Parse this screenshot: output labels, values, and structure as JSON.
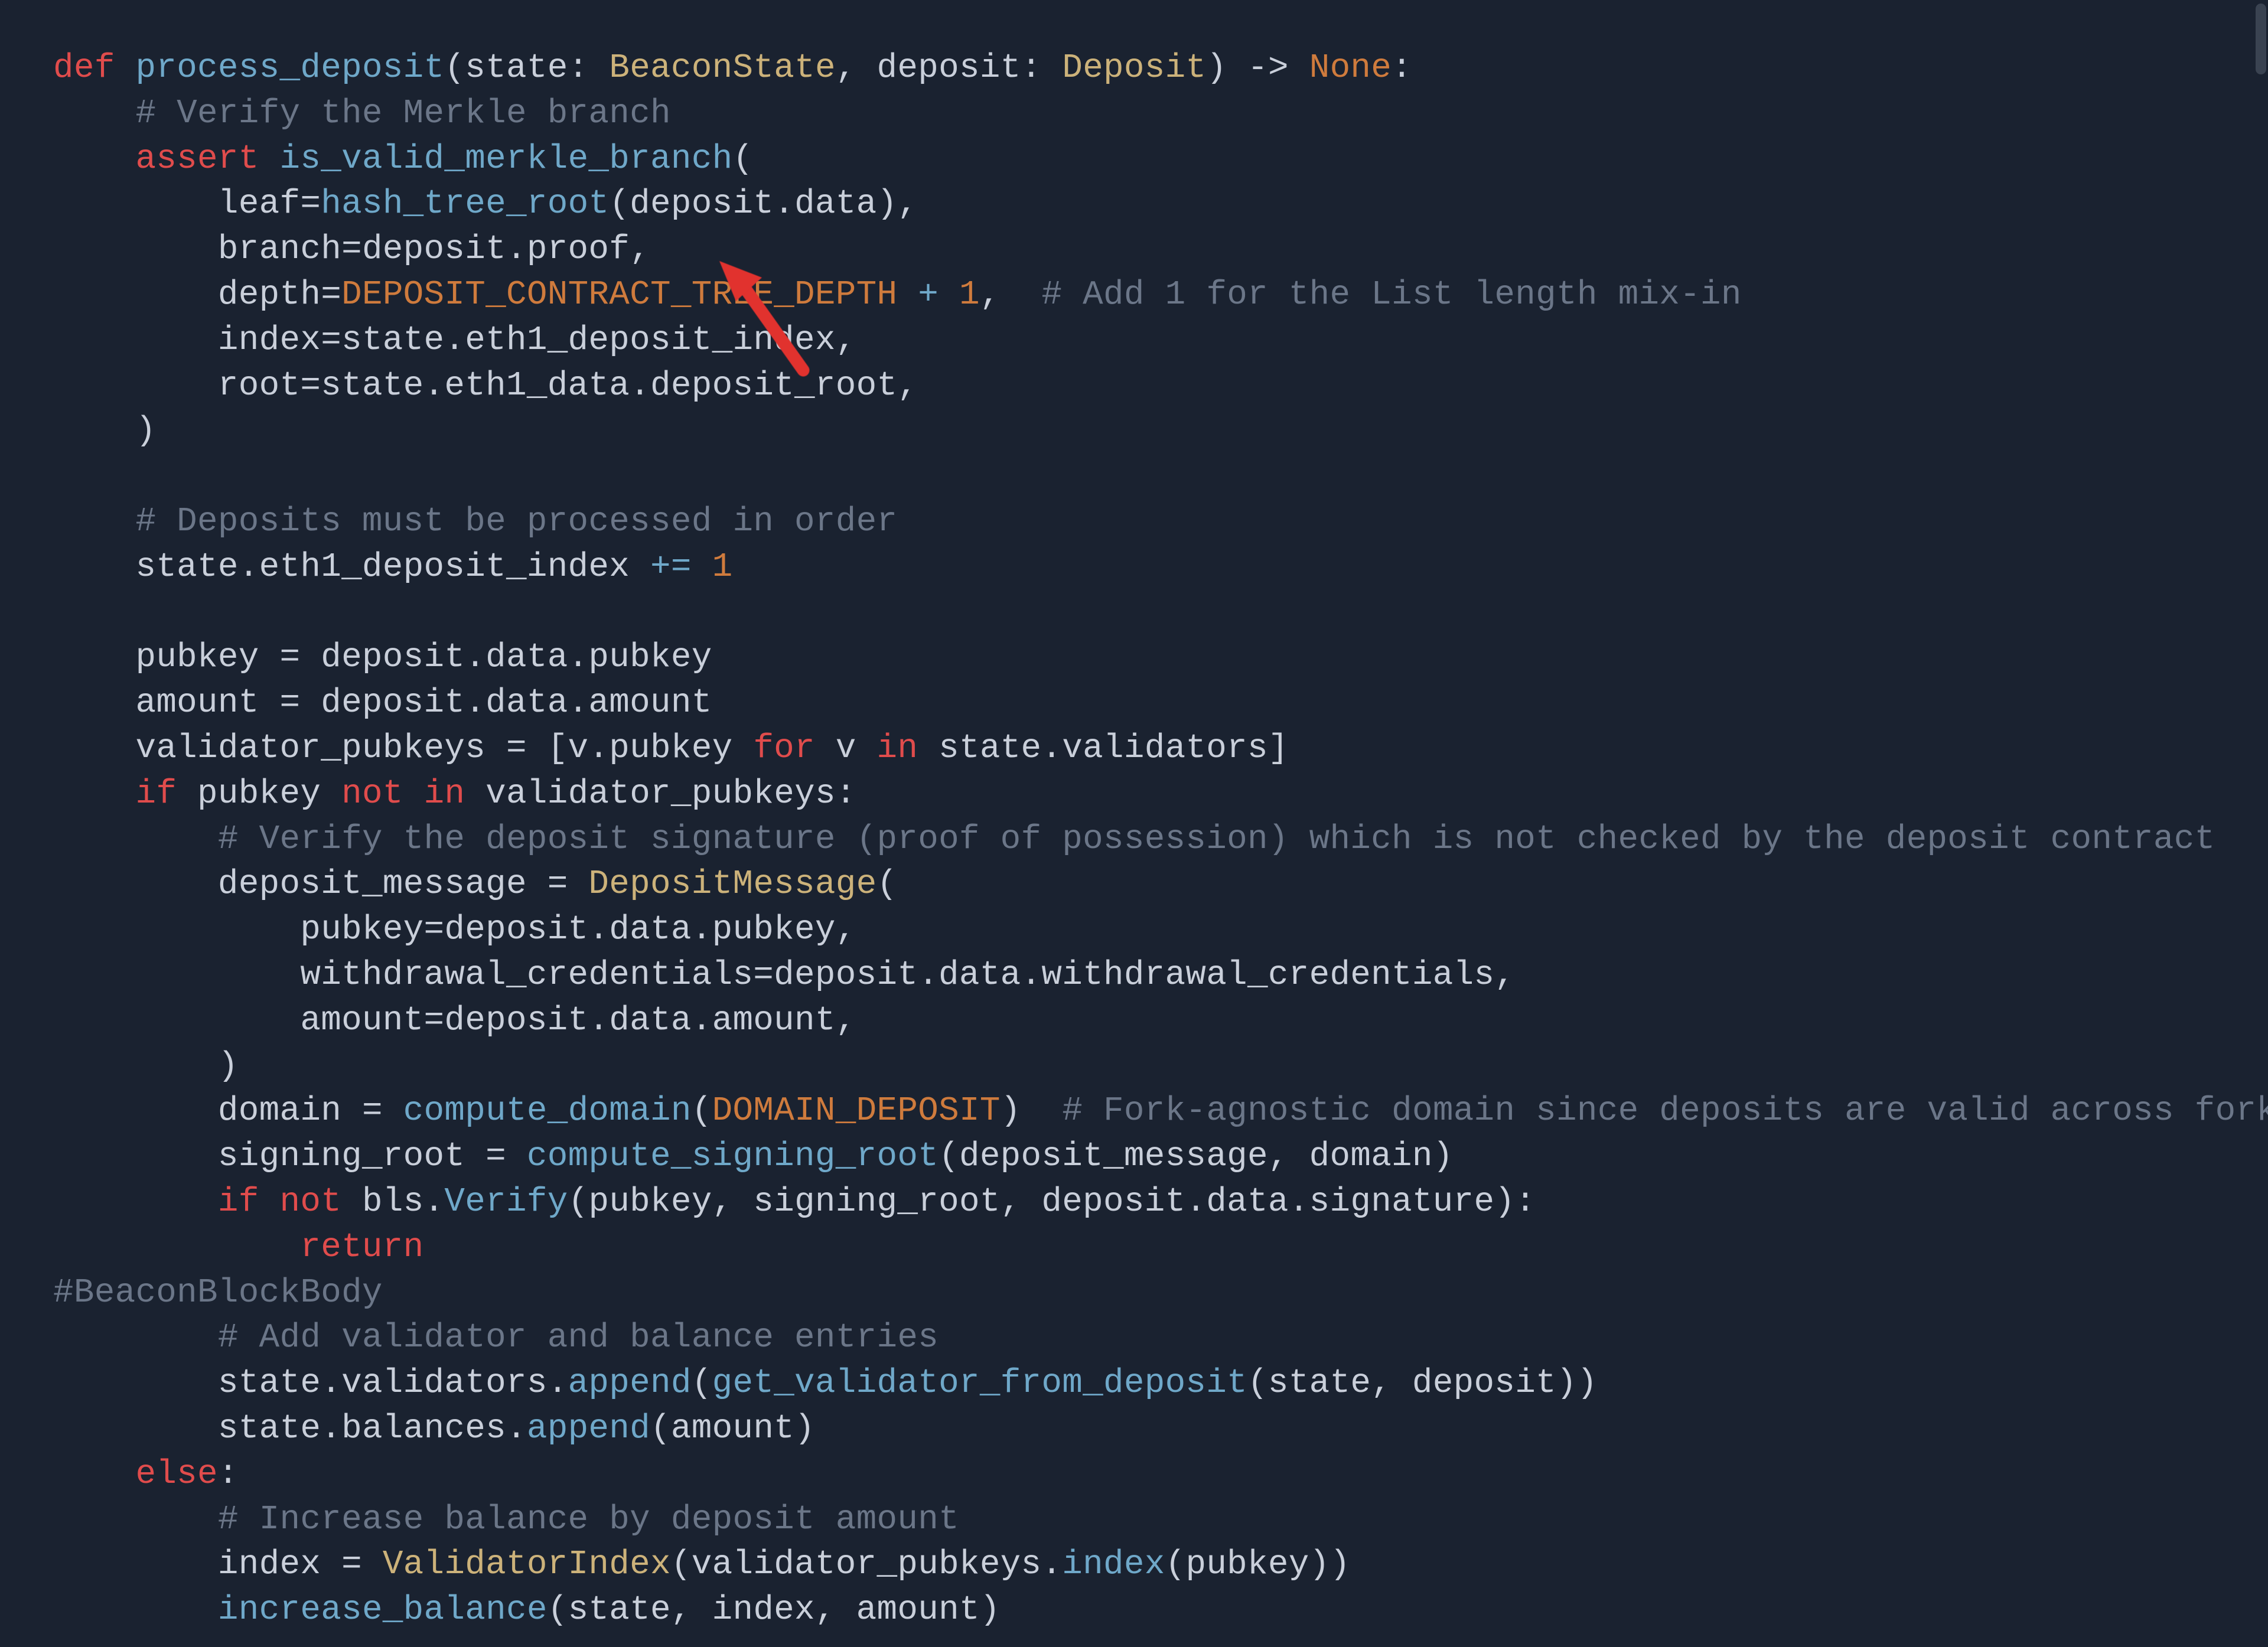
{
  "code": {
    "kw_def": "def",
    "fn_name": "process_deposit",
    "params_open": "(",
    "p1_name": "state",
    "p1_type": "BeaconState",
    "p2_name": "deposit",
    "p2_type": "Deposit",
    "params_close": ")",
    "arrow": " -> ",
    "ret_type": "None",
    "colon": ":",
    "c1": "# Verify the Merkle branch",
    "kw_assert": "assert",
    "fn_is_valid": "is_valid_merkle_branch",
    "open_paren": "(",
    "arg_leaf_k": "leaf",
    "arg_leaf_eq": "=",
    "fn_htr": "hash_tree_root",
    "arg_leaf_v": "(deposit.data),",
    "arg_branch": "branch=deposit.proof,",
    "arg_depth_k": "depth",
    "arg_depth_eq": "=",
    "const_depth": "DEPOSIT_CONTRACT_TREE_DEPTH",
    "plus": " + ",
    "num1": "1",
    "comma": ",",
    "c_depth": "# Add 1 for the List length mix-in",
    "arg_index": "index=state.eth1_deposit_index,",
    "arg_root": "root=state.eth1_data.deposit_root,",
    "close_paren": ")",
    "c2": "# Deposits must be processed in order",
    "stmt_inc": "state.eth1_deposit_index ",
    "op_inc": "+=",
    "num1b": " 1",
    "stmt_pub": "pubkey = deposit.data.pubkey",
    "stmt_amt": "amount = deposit.data.amount",
    "stmt_vp_a": "validator_pubkeys = [v.pubkey ",
    "kw_for": "for",
    "stmt_vp_b": " v ",
    "kw_in": "in",
    "stmt_vp_c": " state.validators]",
    "kw_if": "if",
    "cond_a": " pubkey ",
    "kw_not": "not",
    "sp": " ",
    "kw_in2": "in",
    "cond_b": " validator_pubkeys:",
    "c3": "# Verify the deposit signature (proof of possession) which is not checked by the deposit contract",
    "stmt_dm_a": "deposit_message = ",
    "type_dm": "DepositMessage",
    "dm_open": "(",
    "dm_pub": "pubkey=deposit.data.pubkey,",
    "dm_wc": "withdrawal_credentials=deposit.data.withdrawal_credentials,",
    "dm_amt": "amount=deposit.data.amount,",
    "dm_close": ")",
    "stmt_domain_a": "domain = ",
    "fn_cd": "compute_domain",
    "cd_open": "(",
    "const_dd": "DOMAIN_DEPOSIT",
    "cd_close": ")",
    "c_domain": "# Fork-agnostic domain since deposits are valid across forks",
    "stmt_sr_a": "signing_root = ",
    "fn_csr": "compute_signing_root",
    "csr_args": "(deposit_message, domain)",
    "kw_if2": "if",
    "kw_not2": "not",
    "bls_call_a": " bls.",
    "fn_verify": "Verify",
    "bls_args": "(pubkey, signing_root, deposit.data.signature):",
    "kw_return": "return",
    "c_bbb": "#BeaconBlockBody",
    "c4": "# Add validator and balance entries",
    "stmt_app_v_a": "state.validators.",
    "fn_append": "append",
    "stmt_app_v_b": "(",
    "fn_gvfd": "get_validator_from_deposit",
    "stmt_app_v_c": "(state, deposit))",
    "stmt_app_b_a": "state.balances.",
    "stmt_app_b_b": "(amount)",
    "kw_else": "else",
    "else_colon": ":",
    "c5": "# Increase balance by deposit amount",
    "stmt_idx_a": "index = ",
    "type_vi": "ValidatorIndex",
    "stmt_idx_b": "(validator_pubkeys.",
    "fn_index": "index",
    "stmt_idx_c": "(pubkey))",
    "fn_incbal": "increase_balance",
    "stmt_incbal_args": "(state, index, amount)"
  },
  "annotation": {
    "description": "red-arrow-annotation"
  }
}
